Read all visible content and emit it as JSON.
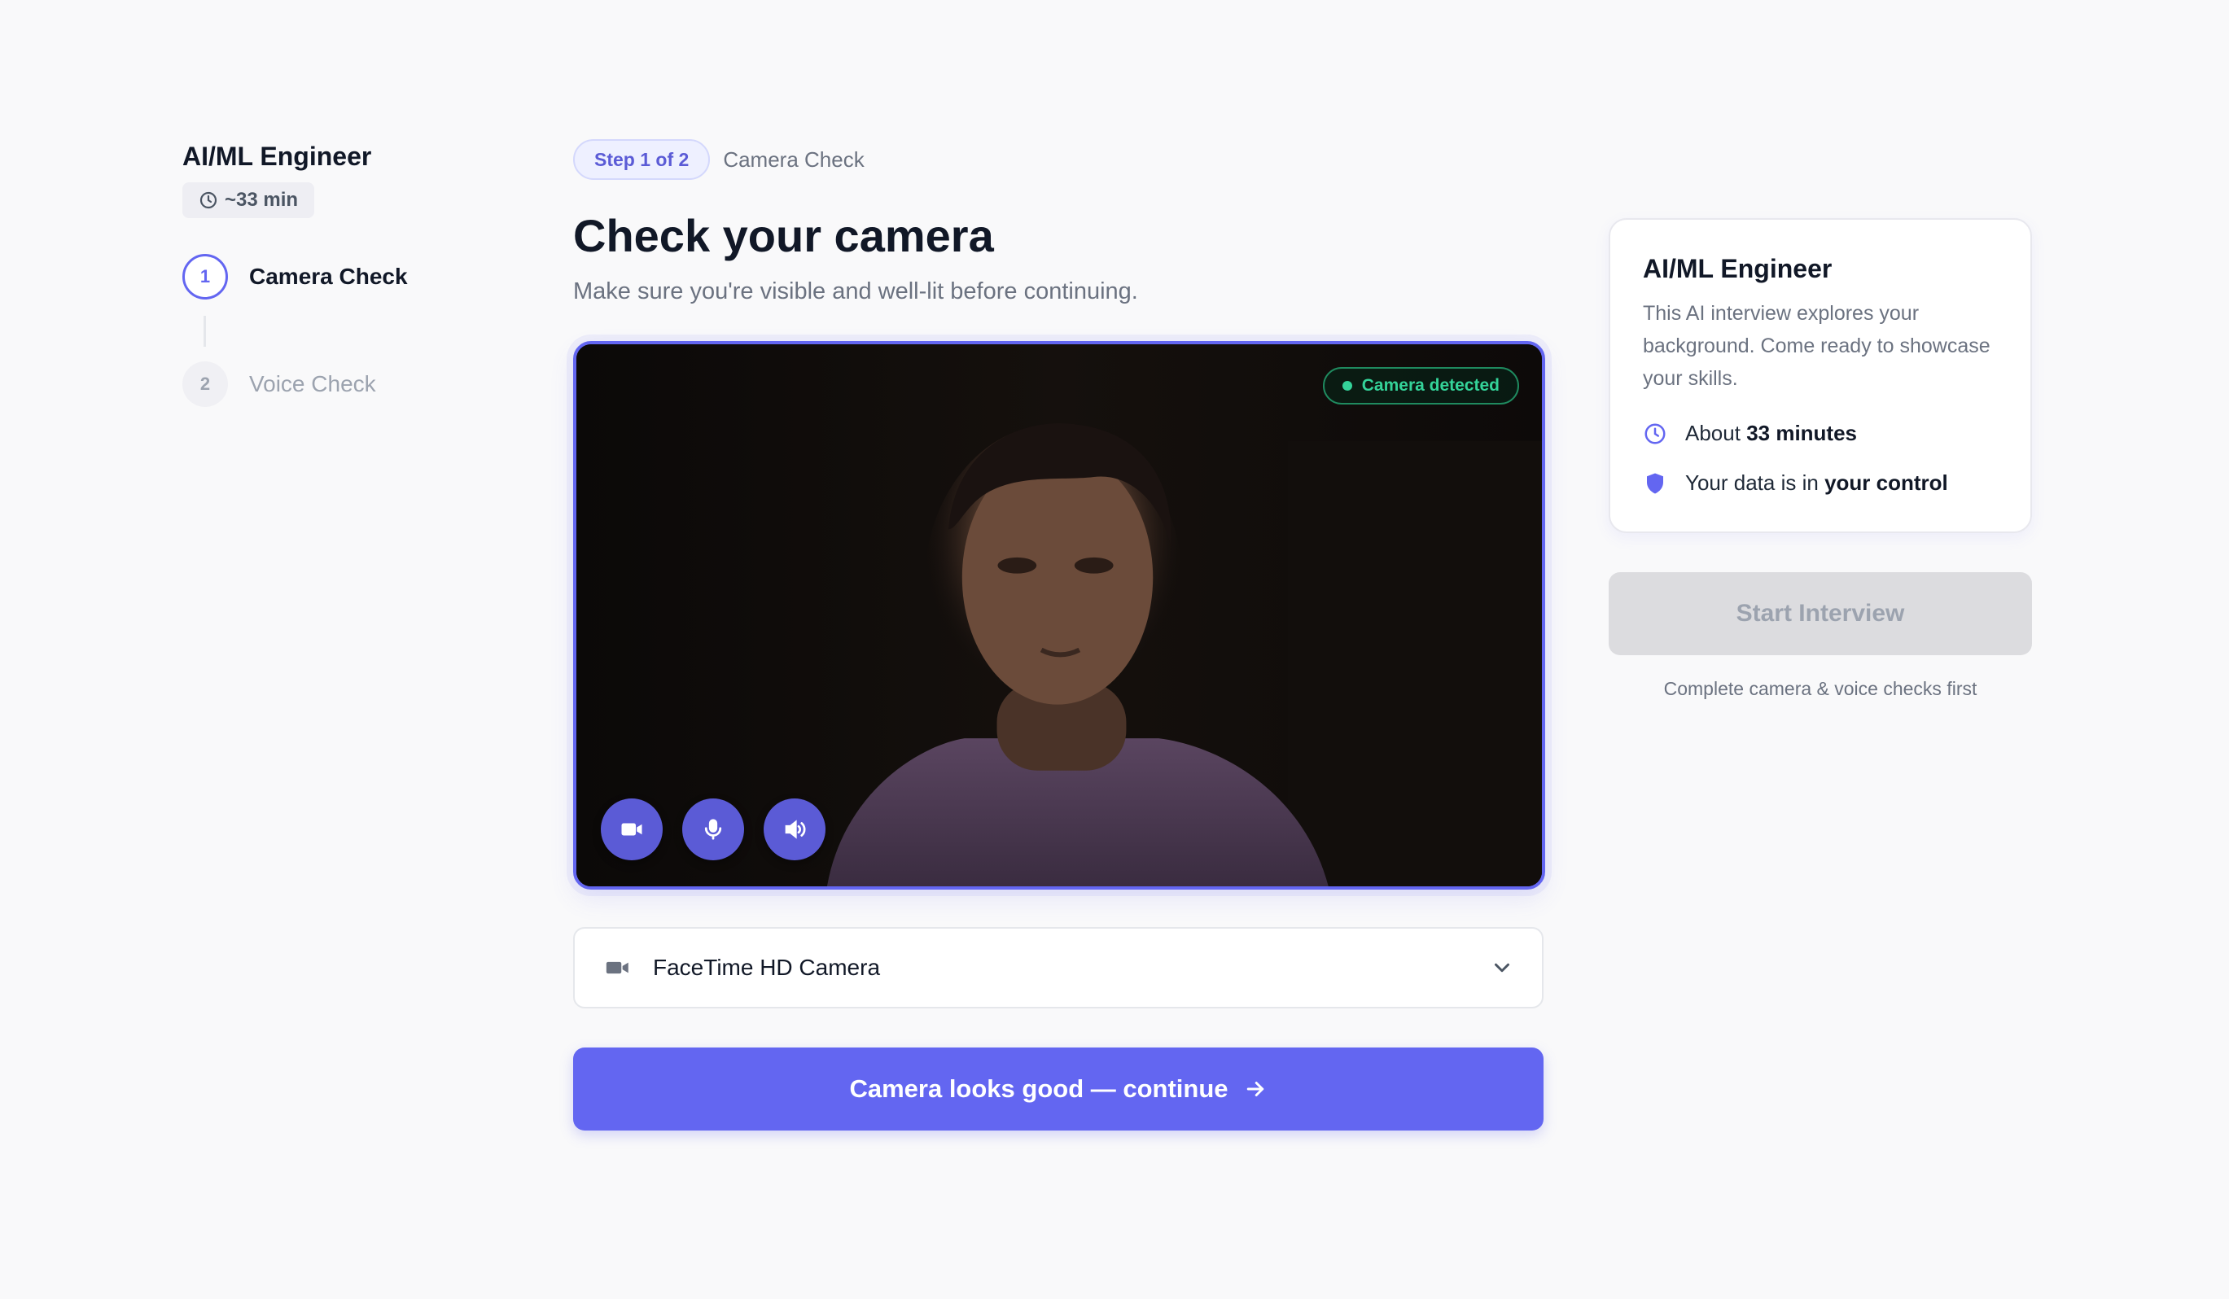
{
  "sidebar": {
    "job_title": "AI/ML Engineer",
    "duration": "~33 min",
    "steps": [
      {
        "number": "1",
        "label": "Camera Check"
      },
      {
        "number": "2",
        "label": "Voice Check"
      }
    ]
  },
  "main": {
    "step_badge": "Step 1 of 2",
    "step_name": "Camera Check",
    "title": "Check your camera",
    "subtitle": "Make sure you're visible and well-lit before continuing.",
    "camera_status": "Camera detected",
    "device": {
      "selected": "FaceTime HD Camera"
    },
    "continue_label": "Camera looks good — continue"
  },
  "info_card": {
    "title": "AI/ML Engineer",
    "description": "This AI interview explores your background. Come ready to showcase your skills.",
    "duration_prefix": "About",
    "duration_value": "33 minutes",
    "privacy_prefix": "Your data is in",
    "privacy_value": "your control"
  },
  "actions": {
    "start_label": "Start Interview",
    "start_hint": "Complete camera & voice checks first"
  },
  "colors": {
    "accent": "#6366f1",
    "success": "#34d399",
    "disabled": "#dcdcdf"
  },
  "icons": {
    "duration": "clock-icon",
    "video_controls": [
      "video-camera-icon",
      "microphone-icon",
      "speaker-icon"
    ],
    "device": "video-camera-icon",
    "dropdown": "chevron-down-icon",
    "continue": "arrow-right-icon",
    "info_duration": "clock-icon",
    "info_privacy": "shield-icon"
  }
}
